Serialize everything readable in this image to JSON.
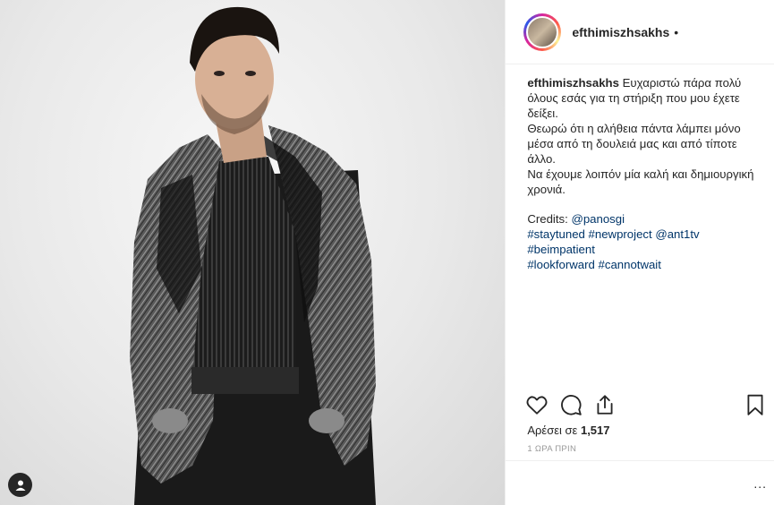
{
  "post": {
    "username": "efthimiszhsakhs",
    "header_separator": "•",
    "caption": {
      "username": "efthimiszhsakhs",
      "line1": "Ευχαριστώ πάρα πολύ όλους εσάς για τη στήριξη που μου έχετε δείξει.",
      "line2": "Θεωρώ ότι η αλήθεια πάντα λάμπει μόνο μέσα από τη δουλειά μας και από τίποτε άλλο.",
      "line3": "Να έχουμε λοιπόν μία καλή και δημιουργική χρονιά.",
      "credits_label": "Credits:",
      "credits_mention": "@panosgi",
      "tags_line1": [
        "#staytuned",
        "#newproject",
        "@ant1tv"
      ],
      "tags_line2": [
        "#beimpatient"
      ],
      "tags_line3": [
        "#lookforward",
        "#cannotwait"
      ]
    },
    "likes_prefix": "Αρέσει σε",
    "likes_count": "1,517",
    "timestamp": "1 ΩΡΑ ΠΡΙΝ",
    "more_options": "...",
    "icons": [
      "heart-icon",
      "comment-icon",
      "share-icon",
      "bookmark-icon",
      "user-tag-icon"
    ],
    "colors": {
      "link": "#003569",
      "text": "#262626",
      "muted": "#999999",
      "border": "#efefef"
    }
  }
}
